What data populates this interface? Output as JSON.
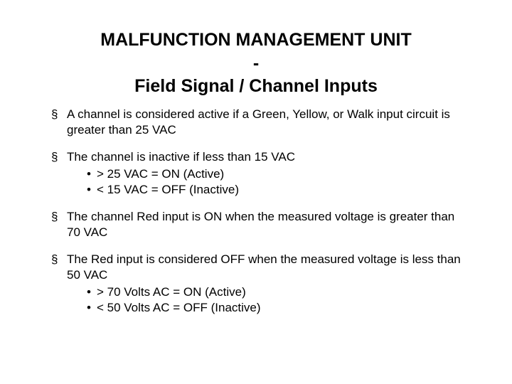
{
  "title_line1": "MALFUNCTION MANAGEMENT UNIT",
  "title_line2": "-",
  "title_line3": "Field Signal / Channel Inputs",
  "bullets": [
    {
      "text": "A channel is considered active if a Green, Yellow, or Walk input circuit is greater than 25 VAC",
      "sub": []
    },
    {
      "text": "The channel is inactive if less than 15 VAC",
      "sub": [
        "> 25 VAC = ON (Active)",
        "< 15 VAC = OFF (Inactive)"
      ]
    },
    {
      "text": "The channel Red input is ON when the measured voltage is greater than 70 VAC",
      "sub": []
    },
    {
      "text": "The Red input is considered OFF when the measured voltage is less than 50 VAC",
      "sub": [
        "> 70 Volts AC = ON (Active)",
        "< 50 Volts AC = OFF (Inactive)"
      ]
    }
  ]
}
